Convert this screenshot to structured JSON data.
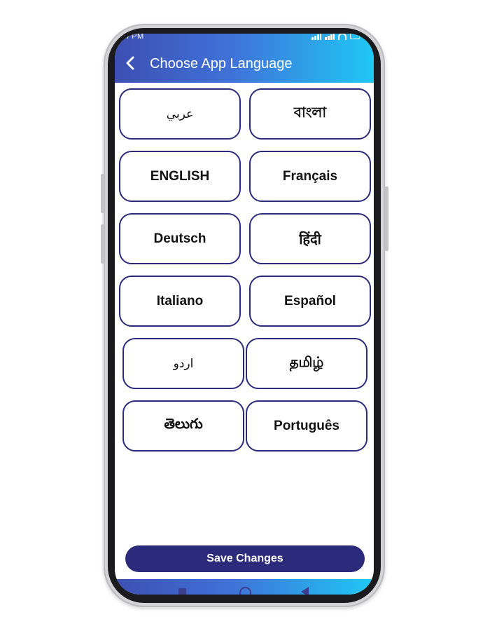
{
  "status_bar": {
    "time": "4 PM"
  },
  "header": {
    "title": "Choose App Language",
    "back_icon": "chevron-left-icon"
  },
  "languages": [
    {
      "label": "عربي"
    },
    {
      "label": "বাংলা"
    },
    {
      "label": "ENGLISH"
    },
    {
      "label": "Français"
    },
    {
      "label": "Deutsch"
    },
    {
      "label": "हिंदी"
    },
    {
      "label": "Italiano"
    },
    {
      "label": "Español"
    },
    {
      "label": "اردو"
    },
    {
      "label": "தமிழ்"
    },
    {
      "label": "తెలుగు"
    },
    {
      "label": "Português"
    }
  ],
  "footer": {
    "save_label": "Save Changes"
  },
  "colors": {
    "accent": "#2c2a7a",
    "header_gradient_start": "#3d4fb3",
    "header_gradient_end": "#1fc8f5"
  }
}
